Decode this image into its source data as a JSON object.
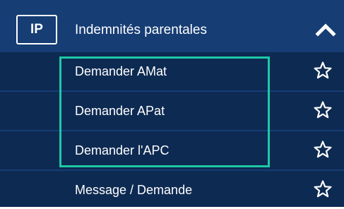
{
  "colors": {
    "header_bg": "#163d74",
    "menu_bg": "#0d2a52",
    "highlight_border": "#1ec8a5",
    "text": "#ffffff"
  },
  "section": {
    "abbreviation": "IP",
    "title": "Indemnités parentales",
    "collapse_icon": "chevron-up-icon",
    "expanded": true
  },
  "items": [
    {
      "label": "Demander AMat",
      "icon": "star-outline-icon",
      "highlighted": true
    },
    {
      "label": "Demander APat",
      "icon": "star-outline-icon",
      "highlighted": true
    },
    {
      "label": "Demander l'APC",
      "icon": "star-outline-icon",
      "highlighted": true
    },
    {
      "label": "Message / Demande",
      "icon": "star-outline-icon",
      "highlighted": false
    }
  ]
}
